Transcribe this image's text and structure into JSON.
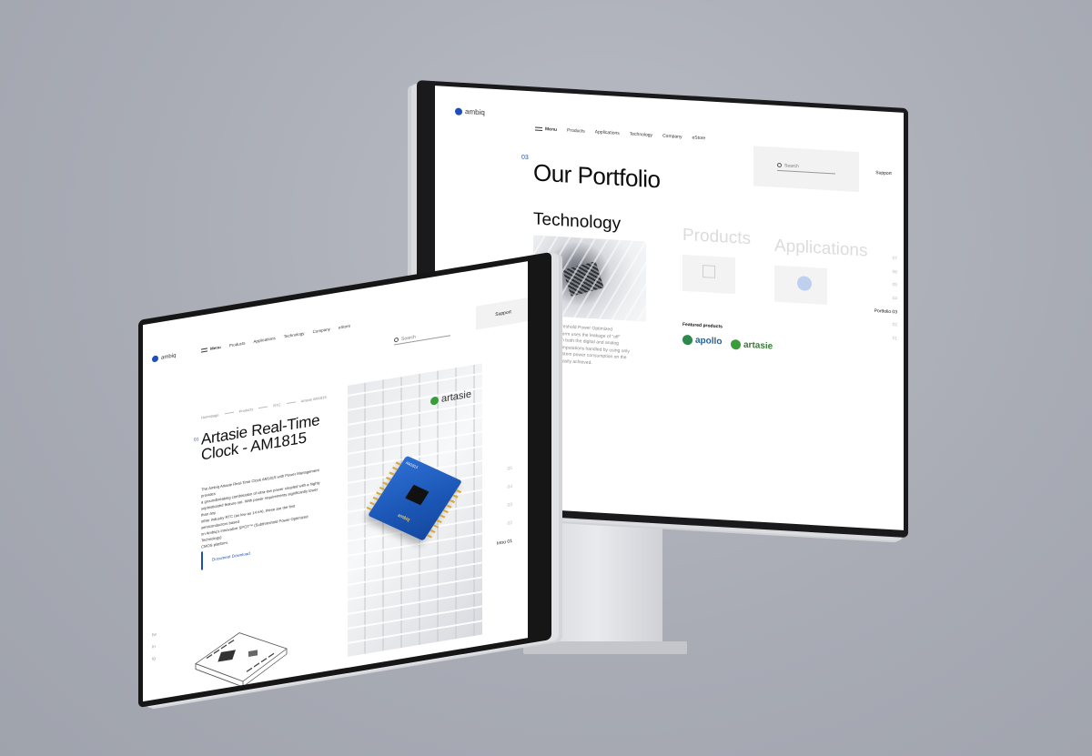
{
  "back_screen": {
    "logo": "ambiq",
    "nav": {
      "menu": "Menu",
      "items": [
        "Products",
        "Applications",
        "Technology",
        "Company",
        "eStore"
      ]
    },
    "search_placeholder": "Search",
    "support": "Support",
    "section_number": "03",
    "title": "Our Portfolio",
    "technology_title": "Technology",
    "faded_products": "Products",
    "faded_applications": "Applications",
    "description": [
      "atented Subthreshold Power Optimized",
      "y (SPOT) platform uses the leakage of \"off\"",
      "s to compute in both the digital and analog",
      ". With most computations handled by using only",
      "urrent, total system power consumption on the",
      "nanowatts is easily achieved."
    ],
    "featured_label": "Featured products",
    "featured": [
      "apollo",
      "artasie"
    ],
    "pager": [
      "07",
      "06",
      "05",
      "04",
      "Portfolio 03",
      "02",
      "01"
    ]
  },
  "front_screen": {
    "logo": "ambiq",
    "nav": {
      "menu": "Menu",
      "items": [
        "Products",
        "Applications",
        "Technology",
        "Company",
        "eStore"
      ]
    },
    "search_placeholder": "Search",
    "support": "Support",
    "breadcrumb": [
      "Homepage",
      "Products",
      "RTC",
      "Artasie AM1815"
    ],
    "section_number": "01",
    "title_line1": "Artasie Real-Time",
    "title_line2": "Clock - AM1815",
    "description": [
      "The Ambiq Artasie Real-Time Clock AM1815 with Power Management provides",
      "a groundbreaking combination of ultra-low power coupled with a highly",
      "sophisticated feature set. With power requirements significantly lower than any",
      "other industry RTC (as low as 14 nA), these are the first semiconductors based",
      "on Ambiq's innovative SPOT™ (Subthreshold Power Optimized Technology)",
      "CMOS platform."
    ],
    "doc_link": "Document Download",
    "social": [
      "tw",
      "in",
      "ig"
    ],
    "photo_logo": "artasie",
    "board_label": "AM1815",
    "board_brand": "ambiq",
    "pager": [
      "05",
      "04",
      "03",
      "02",
      "Intro 01"
    ]
  },
  "colors": {
    "accent": "#1d4fb8",
    "background": "#a9acb5",
    "bezel": "#161617",
    "apollo_green": "#2b8a4a",
    "artasie_green": "#3a9d3a"
  }
}
